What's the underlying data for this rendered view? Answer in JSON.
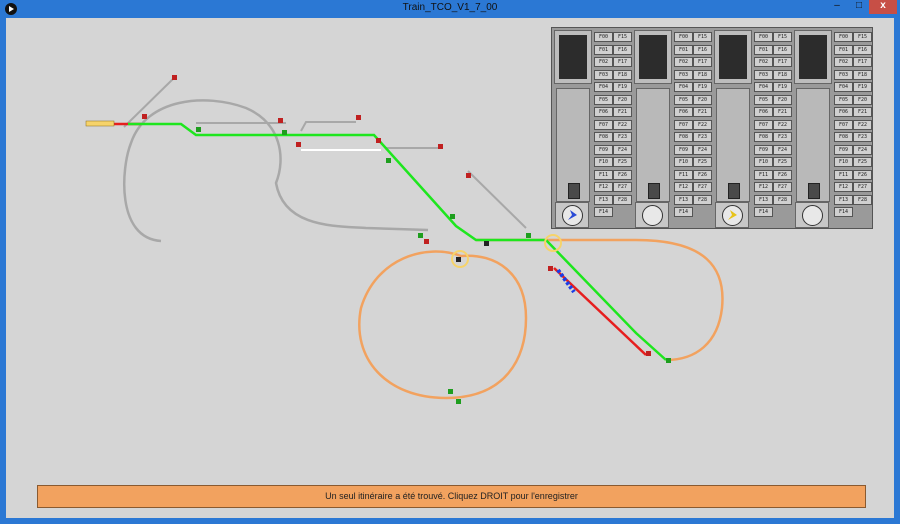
{
  "window": {
    "title": "Train_TCO_V1_7_00",
    "minimize_label": "–",
    "maximize_label": "□",
    "close_label": "x"
  },
  "cab_panel": {
    "cabs": [
      {
        "id": "cab1",
        "direction_arrow_color": "#2b4bd6",
        "function_left": [
          "F00",
          "F01",
          "F02",
          "F03",
          "F04",
          "F05",
          "F06",
          "F07",
          "F08",
          "F09",
          "F10",
          "F11",
          "F12",
          "F13",
          "F14"
        ],
        "function_right": [
          "F15",
          "F16",
          "F17",
          "F18",
          "F19",
          "F20",
          "F21",
          "F22",
          "F23",
          "F24",
          "F25",
          "F26",
          "F27",
          "F28"
        ]
      },
      {
        "id": "cab2",
        "direction_arrow_color": "",
        "function_left": [
          "F00",
          "F01",
          "F02",
          "F03",
          "F04",
          "F05",
          "F06",
          "F07",
          "F08",
          "F09",
          "F10",
          "F11",
          "F12",
          "F13",
          "F14"
        ],
        "function_right": [
          "F15",
          "F16",
          "F17",
          "F18",
          "F19",
          "F20",
          "F21",
          "F22",
          "F23",
          "F24",
          "F25",
          "F26",
          "F27",
          "F28"
        ]
      },
      {
        "id": "cab3",
        "direction_arrow_color": "#e7c31a",
        "function_left": [
          "F00",
          "F01",
          "F02",
          "F03",
          "F04",
          "F05",
          "F06",
          "F07",
          "F08",
          "F09",
          "F10",
          "F11",
          "F12",
          "F13",
          "F14"
        ],
        "function_right": [
          "F15",
          "F16",
          "F17",
          "F18",
          "F19",
          "F20",
          "F21",
          "F22",
          "F23",
          "F24",
          "F25",
          "F26",
          "F27",
          "F28"
        ]
      },
      {
        "id": "cab4",
        "direction_arrow_color": "",
        "function_left": [
          "F00",
          "F01",
          "F02",
          "F03",
          "F04",
          "F05",
          "F06",
          "F07",
          "F08",
          "F09",
          "F10",
          "F11",
          "F12",
          "F13",
          "F14"
        ],
        "function_right": [
          "F15",
          "F16",
          "F17",
          "F18",
          "F19",
          "F20",
          "F21",
          "F22",
          "F23",
          "F24",
          "F25",
          "F26",
          "F27",
          "F28"
        ]
      }
    ]
  },
  "track_colors": {
    "idle": "#a8a8a8",
    "route": "#1ee61e",
    "occupied": "#e61e1e",
    "selected": "#f2a25f",
    "highlight": "#f6d36a",
    "train": "#1a3de6"
  },
  "status": {
    "message": "Un seul itinéraire a été trouvé. Cliquez DROIT pour l'enregistrer"
  }
}
